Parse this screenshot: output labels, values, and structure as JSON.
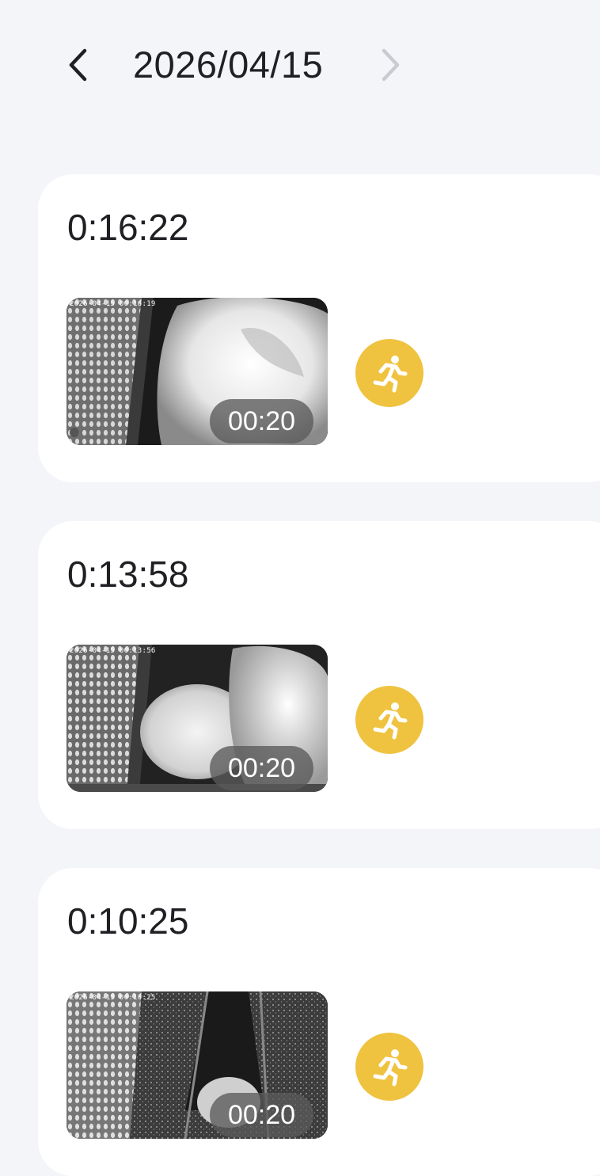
{
  "header": {
    "date": "2026/04/15",
    "prev_icon": "chevron-left-icon",
    "next_icon": "chevron-right-icon",
    "next_disabled": true
  },
  "colors": {
    "background": "#f4f5f9",
    "card": "#ffffff",
    "motion_badge": "#efc340",
    "text": "#1f2024",
    "disabled_chevron": "#c9cbd0"
  },
  "events": [
    {
      "time": "0:16:22",
      "stamp": "2026-04-15 00:16:19",
      "duration": "00:20",
      "type_icon": "running-person-icon"
    },
    {
      "time": "0:13:58",
      "stamp": "2026-04-15 00:13:56",
      "duration": "00:20",
      "type_icon": "running-person-icon"
    },
    {
      "time": "0:10:25",
      "stamp": "2026-04-15 00:10:25",
      "duration": "00:20",
      "type_icon": "running-person-icon"
    }
  ]
}
